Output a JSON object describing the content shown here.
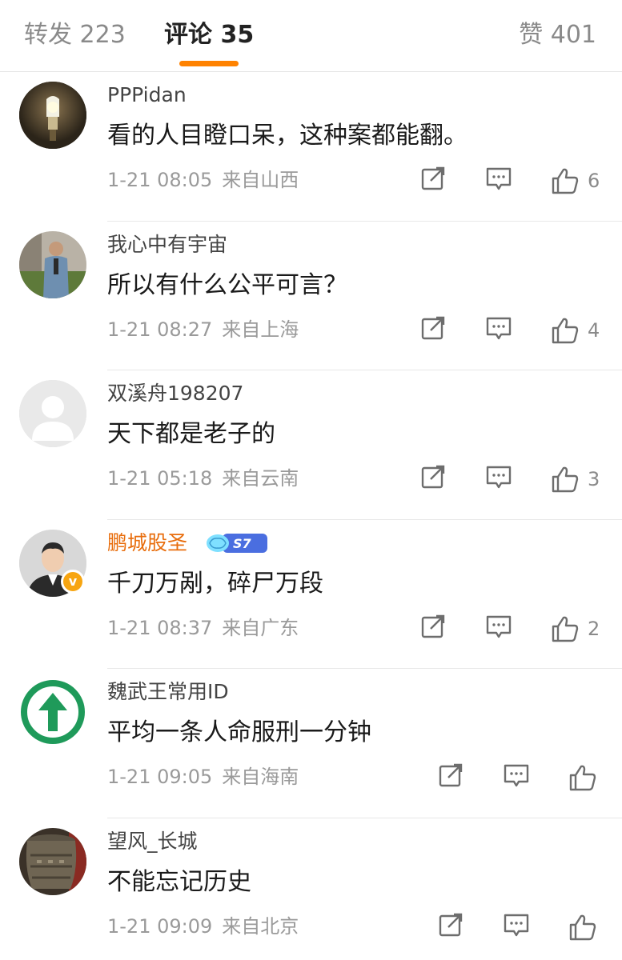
{
  "tabs": {
    "repost": "转发 223",
    "comment": "评论 35",
    "like": "赞 401"
  },
  "colors": {
    "accent": "#ff8200",
    "vip_name": "#e86d0c",
    "verified_badge": "#f7a511"
  },
  "comments": [
    {
      "username": "PPPidan",
      "text": "看的人目瞪口呆，这种案都能翻。",
      "time": "1-21 08:05",
      "location": "来自山西",
      "likes": "6",
      "avatar": "lightbulb-photo"
    },
    {
      "username": "我心中有宇宙",
      "text": "所以有什么公平可言？",
      "time": "1-21 08:27",
      "location": "来自上海",
      "likes": "4",
      "avatar": "person-photo"
    },
    {
      "username": "双溪舟198207",
      "text": "天下都是老子的",
      "time": "1-21 05:18",
      "location": "来自云南",
      "likes": "3",
      "avatar": "default-avatar"
    },
    {
      "username": "鹏城股圣",
      "text": "千刀万剐，碎尸万段",
      "time": "1-21 08:37",
      "location": "来自广东",
      "likes": "2",
      "avatar": "cartoon-man",
      "level_badge": "S7",
      "verified": true
    },
    {
      "username": "魏武王常用ID",
      "text": "平均一条人命服刑一分钟",
      "time": "1-21 09:05",
      "location": "来自海南",
      "likes": "",
      "avatar": "green-up-arrow"
    },
    {
      "username": "望风_长城",
      "text": "不能忘记历史",
      "time": "1-21 09:09",
      "location": "来自北京",
      "likes": "",
      "avatar": "bronze-vessel"
    }
  ]
}
